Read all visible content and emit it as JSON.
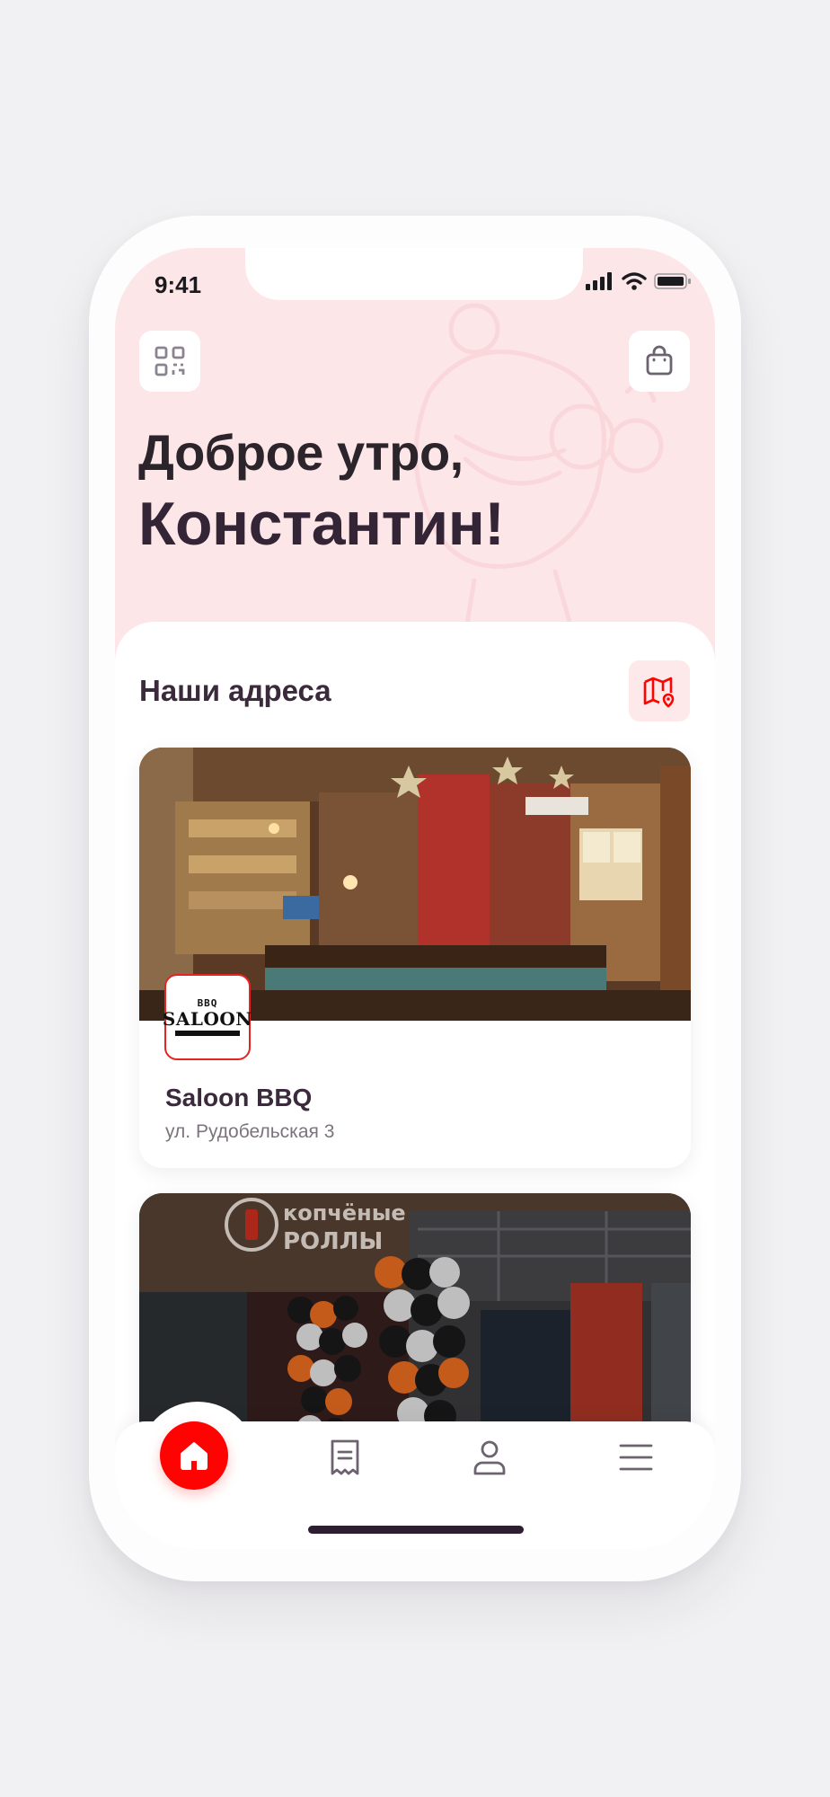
{
  "status_bar": {
    "time": "9:41"
  },
  "header": {
    "greeting_line1": "Доброе утро,",
    "greeting_line2": "Константин!"
  },
  "icons": {
    "qr": "qr-code-icon",
    "bag": "shopping-bag-icon",
    "map": "map-pin-icon",
    "home": "home-icon",
    "orders": "receipt-icon",
    "profile": "user-icon",
    "menu": "hamburger-menu-icon"
  },
  "addresses": {
    "title": "Наши адреса",
    "items": [
      {
        "name": "Saloon BBQ",
        "address": "ул. Рудобельская 3",
        "logo_top": "BBQ",
        "logo_main": "SALOON"
      },
      {
        "sign_line1": "копчёные",
        "sign_line2": "РОЛЛЫ"
      }
    ]
  },
  "colors": {
    "accent": "#ff0303",
    "hero_bg": "#fde6e8",
    "text_dark": "#342536",
    "text_muted": "#7d737d"
  }
}
